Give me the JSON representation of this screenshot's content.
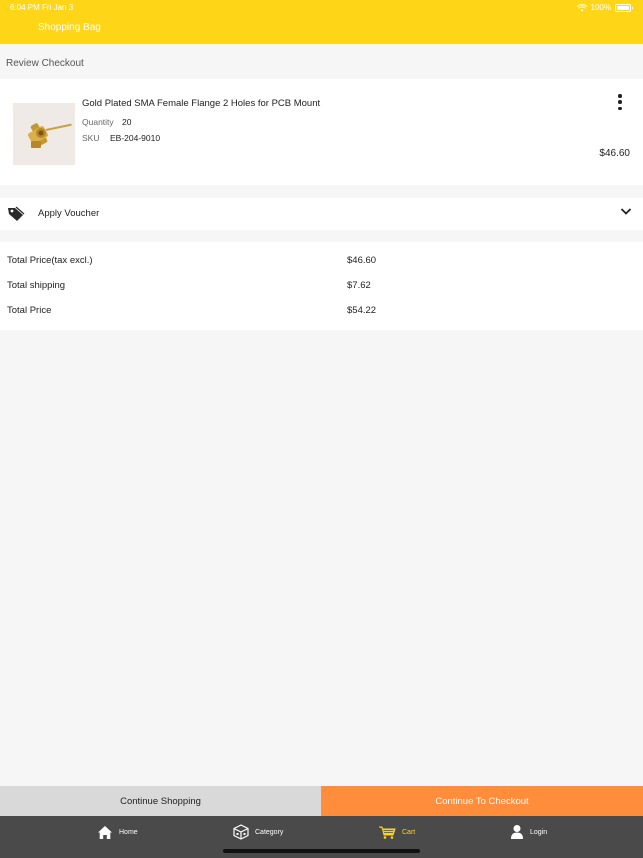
{
  "status": {
    "time": "6:04 PM   Fri Jan 3",
    "battery": "100%"
  },
  "header": {
    "title": "Shopping Bag"
  },
  "section_title": "Review Checkout",
  "product": {
    "name": "Gold Plated SMA Female Flange 2 Holes for PCB Mount",
    "quantity_label": "Quantity",
    "quantity": "20",
    "sku_label": "SKU",
    "sku": "EB-204-9010",
    "price": "$46.60"
  },
  "voucher": {
    "label": "Apply Voucher"
  },
  "totals": [
    {
      "label": "Total Price(tax excl.)",
      "value": "$46.60"
    },
    {
      "label": "Total shipping",
      "value": "$7.62"
    },
    {
      "label": "Total Price",
      "value": "$54.22"
    }
  ],
  "actions": {
    "continue": "Continue Shopping",
    "checkout": "Continue To Checkout"
  },
  "tabs": [
    {
      "label": "Home",
      "icon": "home-icon"
    },
    {
      "label": "Category",
      "icon": "category-icon"
    },
    {
      "label": "Cart",
      "icon": "cart-icon"
    },
    {
      "label": "Login",
      "icon": "user-icon"
    }
  ],
  "colors": {
    "header": "#ffd617",
    "checkout": "#ff8d3c",
    "tabbar": "#4a4a4a"
  }
}
